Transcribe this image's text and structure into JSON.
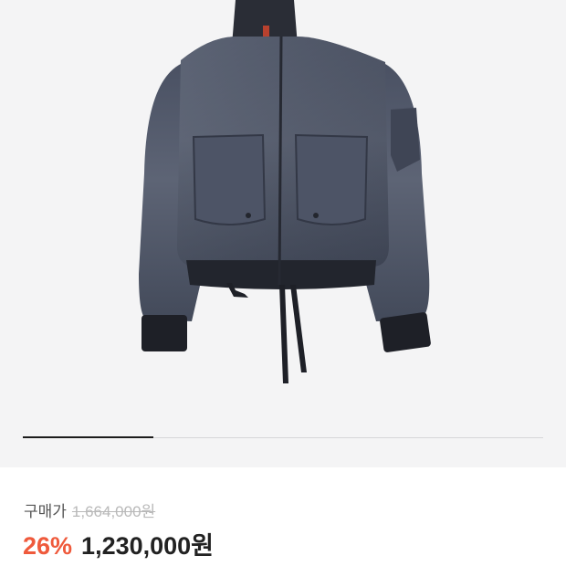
{
  "gallery": {
    "image_alt": "product-photo-bomber-jacket",
    "current_index": 1,
    "total": 4
  },
  "price": {
    "label": "구매가",
    "original": "1,664,000원",
    "discount": "26%",
    "sale": "1,230,000원"
  },
  "colors": {
    "discount": "#ef5a3c",
    "text": "#222222",
    "muted": "#b9b9b9",
    "gallery_bg": "#f4f4f5"
  }
}
